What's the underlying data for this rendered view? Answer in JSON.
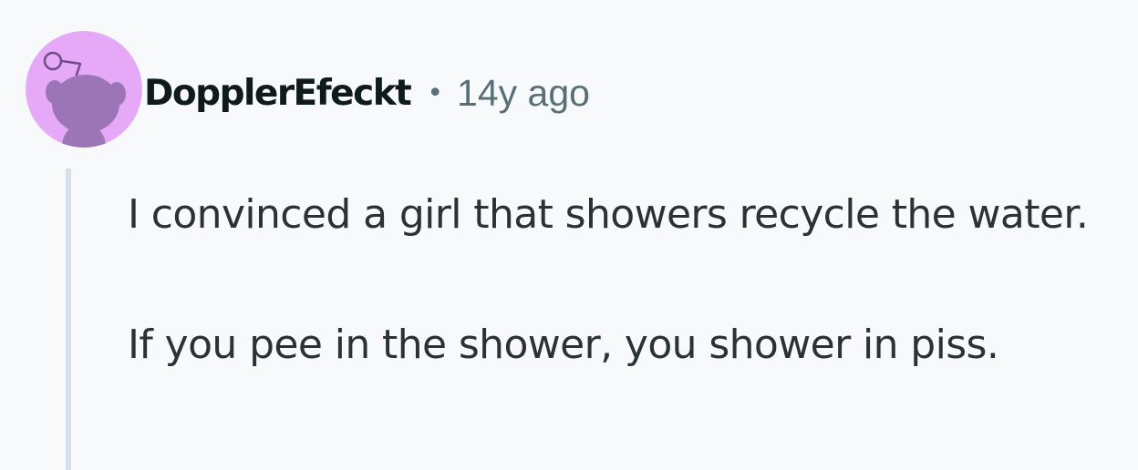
{
  "comment": {
    "author": "DopplerEfeckt",
    "separator": "•",
    "age": "14y ago",
    "paragraphs": [
      "I convinced a girl that showers recycle the water.",
      "If you pee in the shower, you shower in piss."
    ]
  },
  "colors": {
    "background": "#f8f9fb",
    "avatar_bg": "#e6a9f7",
    "avatar_figure": "#9c75b6",
    "author_text": "#0f1a1c",
    "meta_text": "#576f76",
    "body_text": "#2a3236",
    "thread_line": "#d7dfe8"
  },
  "icons": {
    "avatar": "snoo-avatar-icon"
  }
}
